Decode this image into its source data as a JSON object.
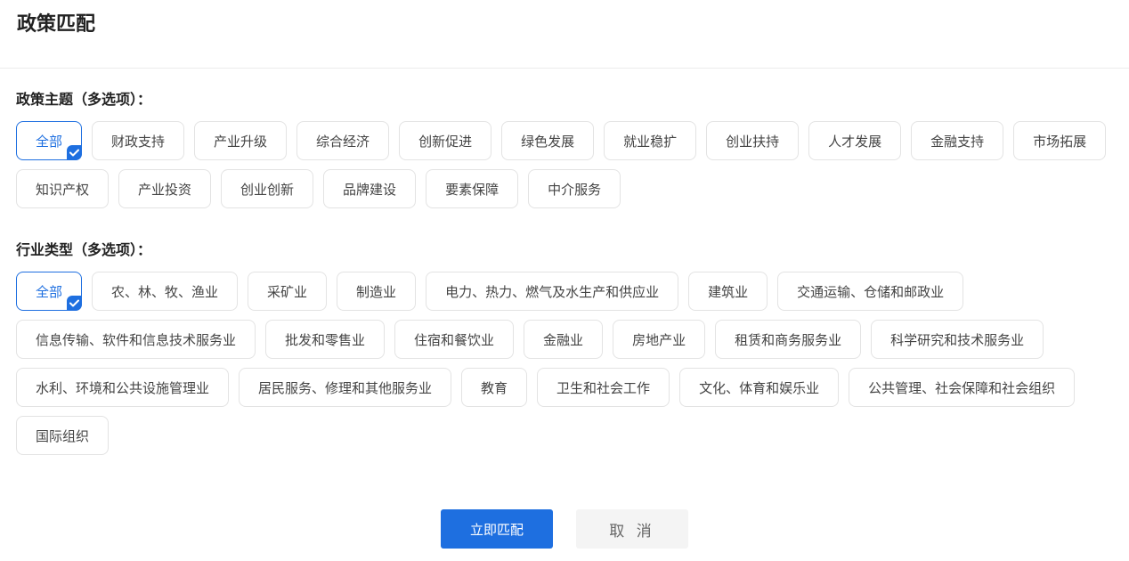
{
  "page": {
    "title": "政策匹配"
  },
  "policy_topics": {
    "label": "政策主题（多选项）：",
    "selected": "全部",
    "items": [
      "全部",
      "财政支持",
      "产业升级",
      "综合经济",
      "创新促进",
      "绿色发展",
      "就业稳扩",
      "创业扶持",
      "人才发展",
      "金融支持",
      "市场拓展",
      "知识产权",
      "产业投资",
      "创业创新",
      "品牌建设",
      "要素保障",
      "中介服务"
    ]
  },
  "industry_types": {
    "label": "行业类型（多选项）：",
    "selected": "全部",
    "items": [
      "全部",
      "农、林、牧、渔业",
      "采矿业",
      "制造业",
      "电力、热力、燃气及水生产和供应业",
      "建筑业",
      "交通运输、仓储和邮政业",
      "信息传输、软件和信息技术服务业",
      "批发和零售业",
      "住宿和餐饮业",
      "金融业",
      "房地产业",
      "租赁和商务服务业",
      "科学研究和技术服务业",
      "水利、环境和公共设施管理业",
      "居民服务、修理和其他服务业",
      "教育",
      "卫生和社会工作",
      "文化、体育和娱乐业",
      "公共管理、社会保障和社会组织",
      "国际组织"
    ]
  },
  "actions": {
    "match_label": "立即匹配",
    "cancel_label": "取 消"
  },
  "colors": {
    "accent": "#1e6fe0",
    "border": "#e3e3e3",
    "cancel_bg": "#f4f4f4"
  },
  "icons": {
    "selected_marker": "checkmark-icon"
  }
}
